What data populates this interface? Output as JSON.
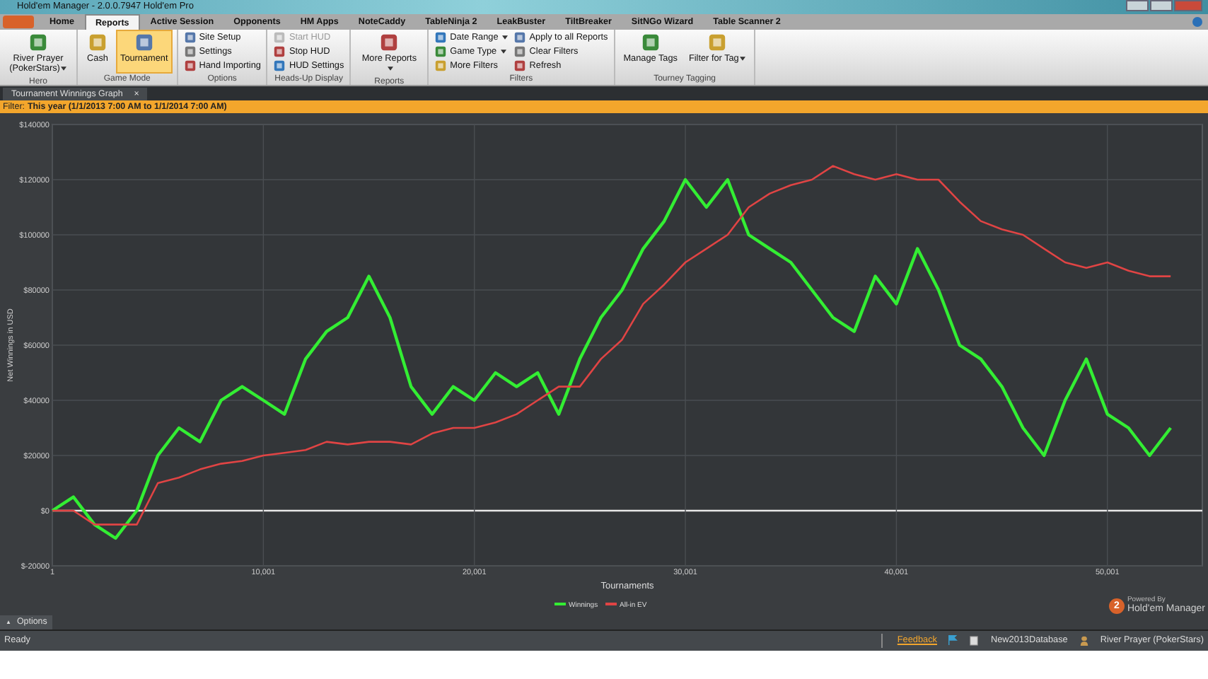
{
  "window": {
    "title": "Hold'em Manager - 2.0.0.7947 Hold'em Pro"
  },
  "ribbon_tabs": [
    {
      "label": "Home",
      "selected": false
    },
    {
      "label": "Reports",
      "selected": true
    },
    {
      "label": "Active Session",
      "selected": false
    },
    {
      "label": "Opponents",
      "selected": false
    },
    {
      "label": "HM Apps",
      "selected": false
    },
    {
      "label": "NoteCaddy",
      "selected": false
    },
    {
      "label": "TableNinja 2",
      "selected": false
    },
    {
      "label": "LeakBuster",
      "selected": false
    },
    {
      "label": "TiltBreaker",
      "selected": false
    },
    {
      "label": "SitNGo Wizard",
      "selected": false
    },
    {
      "label": "Table Scanner 2",
      "selected": false
    }
  ],
  "ribbon_groups": [
    {
      "label": "Hero",
      "items": [
        {
          "kind": "large",
          "label": "River Prayer (PokerStars)",
          "dropdown": true,
          "disabled": false
        }
      ]
    },
    {
      "label": "Game Mode",
      "items": [
        {
          "kind": "large",
          "label": "Cash",
          "dropdown": false,
          "selected": false,
          "disabled": false
        },
        {
          "kind": "large",
          "label": "Tournament",
          "dropdown": false,
          "selected": true,
          "disabled": false
        }
      ]
    },
    {
      "label": "Options",
      "items": [
        {
          "kind": "small",
          "label": "Site Setup",
          "dropdown": false,
          "disabled": false
        },
        {
          "kind": "small",
          "label": "Settings",
          "dropdown": false,
          "disabled": false
        },
        {
          "kind": "small",
          "label": "Hand Importing",
          "dropdown": false,
          "disabled": false
        }
      ]
    },
    {
      "label": "Heads-Up Display",
      "items": [
        {
          "kind": "small",
          "label": "Start HUD",
          "dropdown": false,
          "disabled": true
        },
        {
          "kind": "small",
          "label": "Stop HUD",
          "dropdown": false,
          "disabled": false
        },
        {
          "kind": "small",
          "label": "HUD Settings",
          "dropdown": false,
          "disabled": false
        }
      ]
    },
    {
      "label": "Reports",
      "items": [
        {
          "kind": "large",
          "label": "More Reports",
          "dropdown": true,
          "disabled": false
        }
      ]
    },
    {
      "label": "Filters",
      "items": [
        {
          "kind": "small",
          "label": "Date Range",
          "dropdown": true,
          "disabled": false
        },
        {
          "kind": "small",
          "label": "Game Type",
          "dropdown": true,
          "disabled": false
        },
        {
          "kind": "small",
          "label": "More Filters",
          "dropdown": false,
          "disabled": false
        },
        {
          "kind": "small",
          "label": "Apply to all Reports",
          "dropdown": false,
          "disabled": false
        },
        {
          "kind": "small",
          "label": "Clear Filters",
          "dropdown": false,
          "disabled": false
        },
        {
          "kind": "small",
          "label": "Refresh",
          "dropdown": false,
          "disabled": false
        }
      ]
    },
    {
      "label": "Tourney Tagging",
      "items": [
        {
          "kind": "large",
          "label": "Manage Tags",
          "dropdown": false,
          "disabled": false
        },
        {
          "kind": "large",
          "label": "Filter for Tag",
          "dropdown": true,
          "disabled": false
        }
      ]
    }
  ],
  "document_tab": {
    "label": "Tournament Winnings Graph",
    "close": "×"
  },
  "filter_bar": {
    "label": "Filter:",
    "value": "This year (1/1/2013 7:00 AM to 1/1/2014 7:00 AM)"
  },
  "chart": {
    "chart_data": {
      "type": "line",
      "xlabel": "Tournaments",
      "ylabel": "Net Winnings in USD",
      "x": [
        1,
        1000,
        2000,
        3000,
        4000,
        5000,
        6000,
        7000,
        8000,
        9000,
        10000,
        11000,
        12000,
        13000,
        14000,
        15000,
        16000,
        17000,
        18000,
        19000,
        20000,
        21000,
        22000,
        23000,
        24000,
        25000,
        26000,
        27000,
        28000,
        29000,
        30000,
        31000,
        32000,
        33000,
        34000,
        35000,
        36000,
        37000,
        38000,
        39000,
        40000,
        41000,
        42000,
        43000,
        44000,
        45000,
        46000,
        47000,
        48000,
        49000,
        50000,
        51000,
        52000,
        53000
      ],
      "series": [
        {
          "name": "Winnings",
          "color": "#33ee33",
          "values": [
            0,
            5000,
            -5000,
            -10000,
            0,
            20000,
            30000,
            25000,
            40000,
            45000,
            40000,
            35000,
            55000,
            65000,
            70000,
            85000,
            70000,
            45000,
            35000,
            45000,
            40000,
            50000,
            45000,
            50000,
            35000,
            55000,
            70000,
            80000,
            95000,
            105000,
            120000,
            110000,
            120000,
            100000,
            95000,
            90000,
            80000,
            70000,
            65000,
            85000,
            75000,
            95000,
            80000,
            60000,
            55000,
            45000,
            30000,
            20000,
            40000,
            55000,
            35000,
            30000,
            20000,
            30000
          ]
        },
        {
          "name": "All-in EV",
          "color": "#e04444",
          "values": [
            0,
            0,
            -5000,
            -5000,
            -5000,
            10000,
            12000,
            15000,
            17000,
            18000,
            20000,
            21000,
            22000,
            25000,
            24000,
            25000,
            25000,
            24000,
            28000,
            30000,
            30000,
            32000,
            35000,
            40000,
            45000,
            45000,
            55000,
            62000,
            75000,
            82000,
            90000,
            95000,
            100000,
            110000,
            115000,
            118000,
            120000,
            125000,
            122000,
            120000,
            122000,
            120000,
            120000,
            112000,
            105000,
            102000,
            100000,
            95000,
            90000,
            88000,
            90000,
            87000,
            85000,
            85000
          ]
        }
      ],
      "grid": true,
      "legend": true,
      "xlim": [
        1,
        54500
      ],
      "ylim": [
        -20000,
        140000
      ],
      "xticks": [
        {
          "value": 1,
          "label": "1"
        },
        {
          "value": 10001,
          "label": "10,001"
        },
        {
          "value": 20001,
          "label": "20,001"
        },
        {
          "value": 30001,
          "label": "30,001"
        },
        {
          "value": 40001,
          "label": "40,001"
        },
        {
          "value": 50001,
          "label": "50,001"
        }
      ],
      "yticks": [
        {
          "value": -20000,
          "label": "$-20000"
        },
        {
          "value": 0,
          "label": "$0"
        },
        {
          "value": 20000,
          "label": "$20000"
        },
        {
          "value": 40000,
          "label": "$40000"
        },
        {
          "value": 60000,
          "label": "$60000"
        },
        {
          "value": 80000,
          "label": "$80000"
        },
        {
          "value": 100000,
          "label": "$100000"
        },
        {
          "value": 120000,
          "label": "$120000"
        },
        {
          "value": 140000,
          "label": "$140000"
        }
      ]
    },
    "powered_by": "Powered By",
    "brand": "Hold'em Manager",
    "brand_number": "2"
  },
  "options_button": {
    "label": "Options",
    "arrow": "▲"
  },
  "status_bar": {
    "status": "Ready",
    "feedback": "Feedback",
    "database": "New2013Database",
    "player": "River Prayer (PokerStars)"
  }
}
